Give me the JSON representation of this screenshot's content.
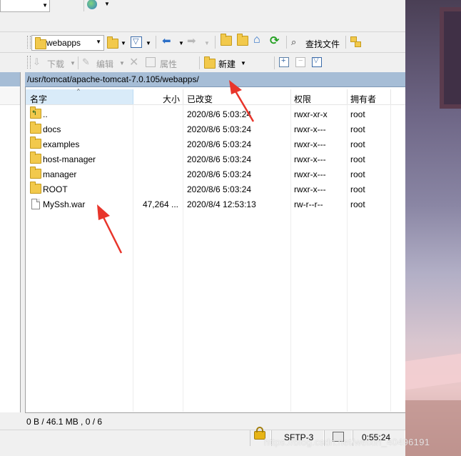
{
  "toolbar1": {
    "path_combo_value": "webapps",
    "find_files_label": "查找文件"
  },
  "toolbar2": {
    "download_label": "下载",
    "edit_label": "编辑",
    "properties_label": "属性",
    "new_label": "新建"
  },
  "path_bar": {
    "path": "/usr/tomcat/apache-tomcat-7.0.105/webapps/"
  },
  "columns": {
    "name": "名字",
    "size": "大小",
    "modified": "已改变",
    "permissions": "权限",
    "owner": "拥有者"
  },
  "files": [
    {
      "name": "..",
      "size": "",
      "modified": "2020/8/6 5:03:24",
      "permissions": "rwxr-xr-x",
      "owner": "root",
      "icon": "parent-folder-icon"
    },
    {
      "name": "docs",
      "size": "",
      "modified": "2020/8/6 5:03:24",
      "permissions": "rwxr-x---",
      "owner": "root",
      "icon": "folder-icon"
    },
    {
      "name": "examples",
      "size": "",
      "modified": "2020/8/6 5:03:24",
      "permissions": "rwxr-x---",
      "owner": "root",
      "icon": "folder-icon"
    },
    {
      "name": "host-manager",
      "size": "",
      "modified": "2020/8/6 5:03:24",
      "permissions": "rwxr-x---",
      "owner": "root",
      "icon": "folder-icon"
    },
    {
      "name": "manager",
      "size": "",
      "modified": "2020/8/6 5:03:24",
      "permissions": "rwxr-x---",
      "owner": "root",
      "icon": "folder-icon"
    },
    {
      "name": "ROOT",
      "size": "",
      "modified": "2020/8/6 5:03:24",
      "permissions": "rwxr-x---",
      "owner": "root",
      "icon": "folder-icon"
    },
    {
      "name": "MySsh.war",
      "size": "47,264 ...",
      "modified": "2020/8/4 12:53:13",
      "permissions": "rw-r--r--",
      "owner": "root",
      "icon": "file-icon"
    }
  ],
  "status": {
    "selection_info": "0 B / 46.1 MB ,  0 / 6",
    "protocol": "SFTP-3",
    "elapsed": "0:55:24"
  },
  "watermark": "https://blog.csdn.net/weixin_40496191",
  "colors": {
    "path_bar": "#a6bdd6",
    "selected_header": "#d9ebf9",
    "annotation_arrow": "#e8352b"
  }
}
